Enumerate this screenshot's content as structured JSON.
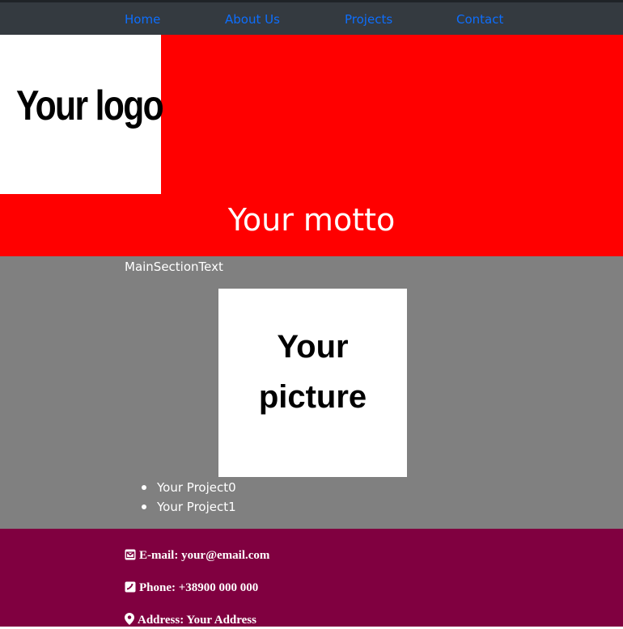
{
  "nav": {
    "items": [
      {
        "label": "Home"
      },
      {
        "label": "About Us"
      },
      {
        "label": "Projects"
      },
      {
        "label": "Contact"
      }
    ],
    "link_color": "#0d6efd",
    "background": "#343a40"
  },
  "hero": {
    "logo_text": "Your logo",
    "motto": "Your motto",
    "background": "#ff0000"
  },
  "main": {
    "section_text": "MainSectionText",
    "picture_text": [
      "Your",
      "picture"
    ],
    "projects": [
      "Your Project0",
      "Your Project1"
    ],
    "background": "#808080"
  },
  "footer": {
    "email_label": "E-mail: your@email.com",
    "phone_label": "Phone: +38900 000 000",
    "address_label": "Address: Your Address",
    "background": "#800040",
    "icons": [
      "envelope-icon",
      "phone-icon",
      "map-marker-icon"
    ]
  }
}
